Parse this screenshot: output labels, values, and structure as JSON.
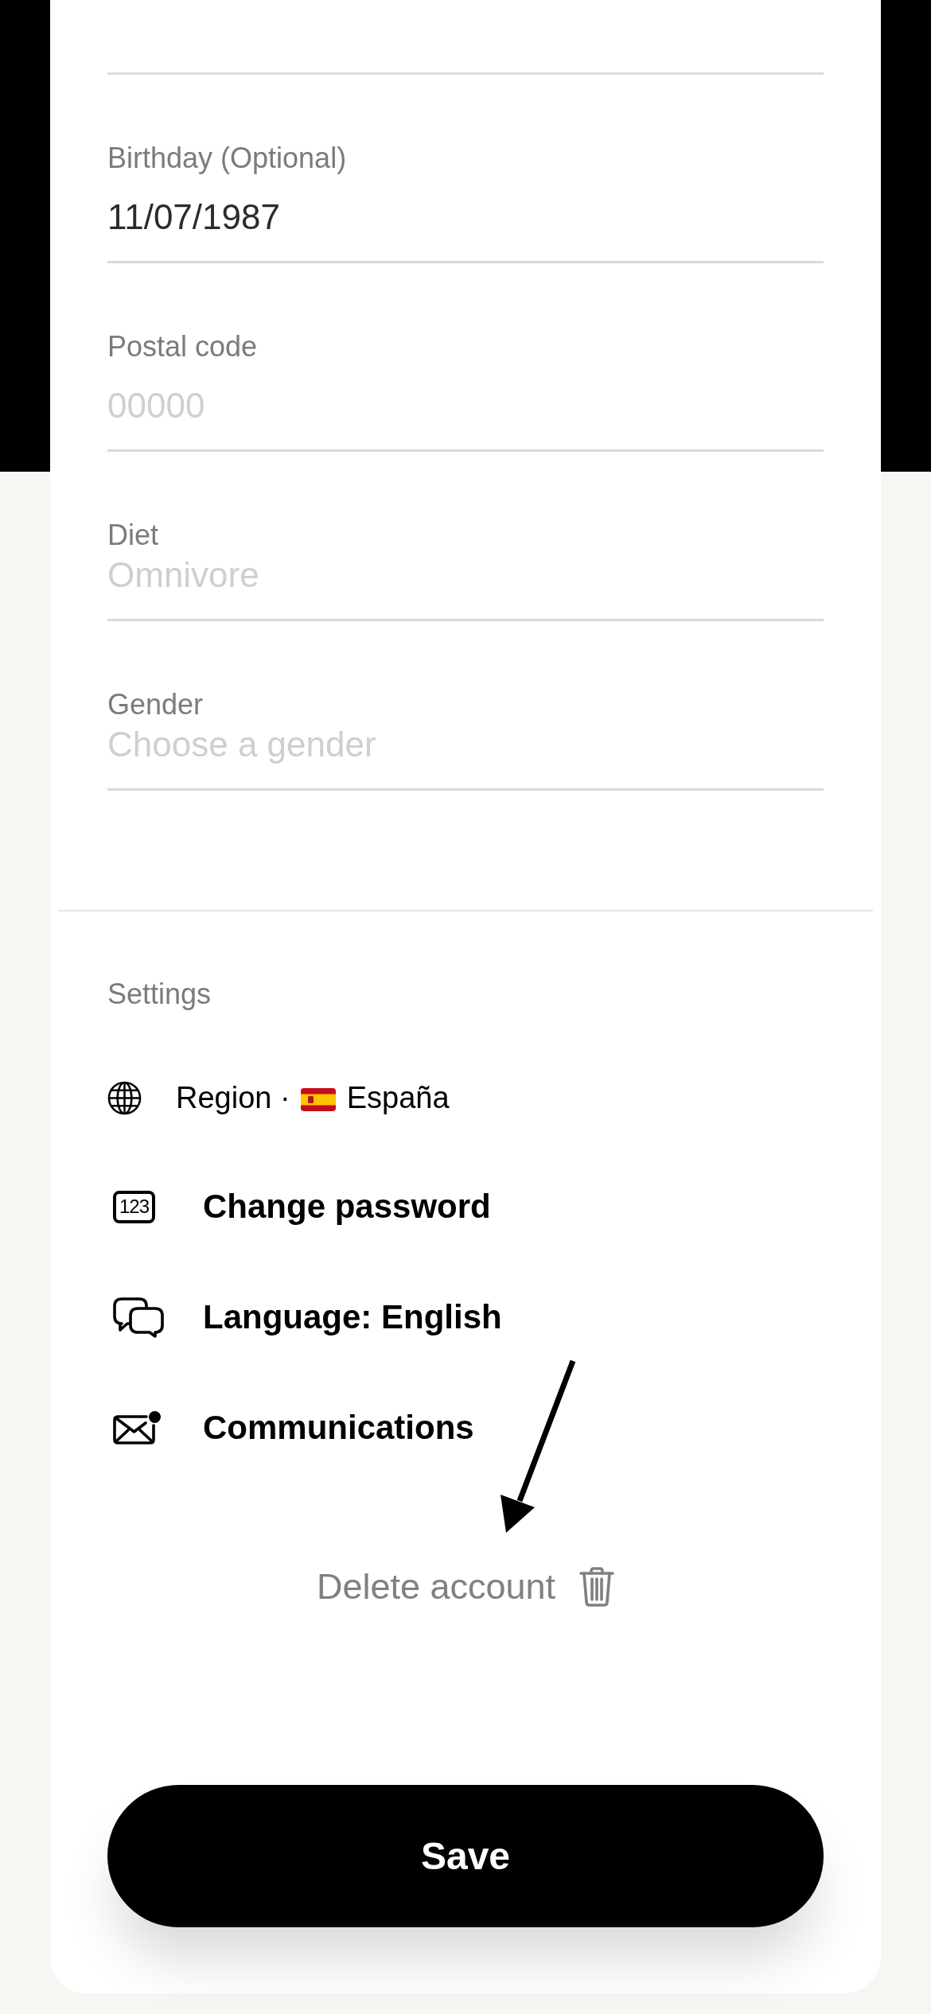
{
  "profile_form": {
    "fields": [
      {
        "kind": "text",
        "label": "Birthday (Optional)",
        "value": "11/07/1987"
      },
      {
        "kind": "text",
        "label": "Postal code",
        "placeholder": "00000"
      },
      {
        "kind": "select",
        "label": "Diet",
        "placeholder": "Omnivore"
      },
      {
        "kind": "select",
        "label": "Gender",
        "placeholder": "Choose a gender"
      }
    ]
  },
  "settings": {
    "title": "Settings",
    "items": [
      {
        "kind": "region",
        "label": "Region",
        "separator": "·",
        "value": "España",
        "has_notification": false
      },
      {
        "kind": "password",
        "icon_text": "123",
        "label": "Change password",
        "has_notification": false
      },
      {
        "kind": "language",
        "label": "Language: English",
        "has_notification": false
      },
      {
        "kind": "communications",
        "label": "Communications",
        "has_notification": true
      }
    ]
  },
  "delete_account": {
    "label": "Delete account"
  },
  "save_button": {
    "label": "Save"
  }
}
